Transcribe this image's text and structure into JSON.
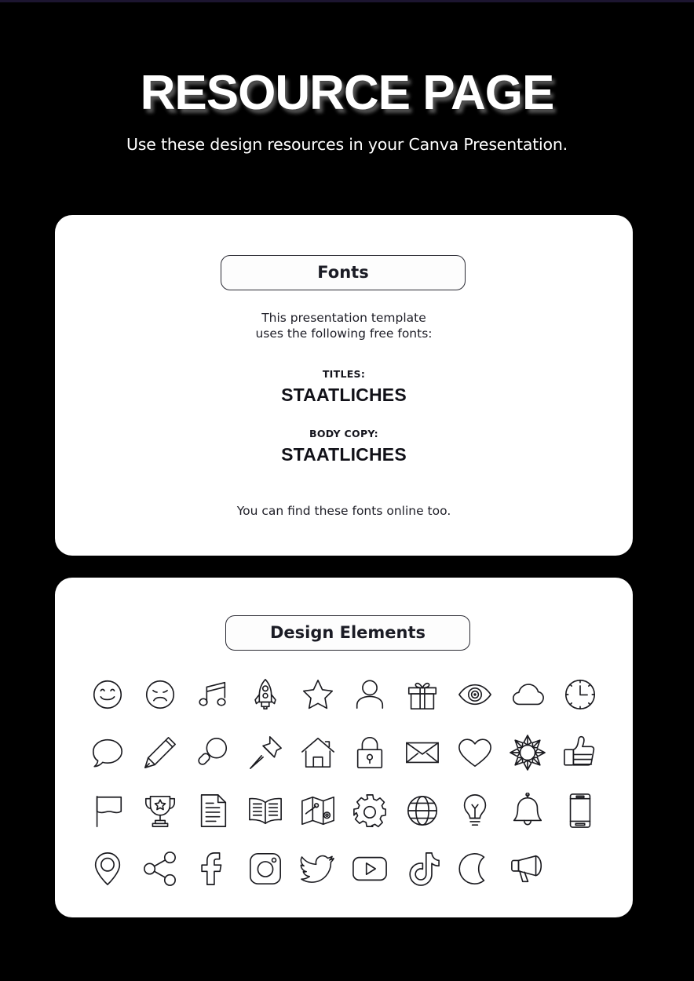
{
  "theme": {
    "background": "#000000",
    "top_strip": "#1c1530",
    "card_background": "#ffffff",
    "text_dark": "#1b1c25",
    "text_light": "#ffffff",
    "icon_stroke": "#1a1a1f"
  },
  "header": {
    "title": "RESOURCE PAGE",
    "subtitle": "Use these design resources in your Canva Presentation."
  },
  "fonts_card": {
    "pill_label": "Fonts",
    "intro_line1": "This presentation template",
    "intro_line2": "uses the following free fonts:",
    "titles_label": "TITLES:",
    "titles_font": "STAATLICHES",
    "body_label": "BODY COPY:",
    "body_font": "STAATLICHES",
    "footer": "You can find these fonts online too."
  },
  "elements_card": {
    "pill_label": "Design Elements",
    "icons": [
      {
        "name": "smiley-face-icon",
        "label": "Smiley Face"
      },
      {
        "name": "sad-face-icon",
        "label": "Sad Face"
      },
      {
        "name": "music-note-icon",
        "label": "Music Note"
      },
      {
        "name": "rocket-icon",
        "label": "Rocket"
      },
      {
        "name": "star-icon",
        "label": "Star"
      },
      {
        "name": "person-icon",
        "label": "Person"
      },
      {
        "name": "gift-icon",
        "label": "Gift"
      },
      {
        "name": "eye-icon",
        "label": "Eye"
      },
      {
        "name": "cloud-icon",
        "label": "Cloud"
      },
      {
        "name": "clock-icon",
        "label": "Clock"
      },
      {
        "name": "speech-bubble-icon",
        "label": "Speech Bubble"
      },
      {
        "name": "pencil-icon",
        "label": "Pencil"
      },
      {
        "name": "magnifier-icon",
        "label": "Magnifying Glass"
      },
      {
        "name": "pushpin-icon",
        "label": "Pushpin"
      },
      {
        "name": "house-icon",
        "label": "House"
      },
      {
        "name": "lock-icon",
        "label": "Lock"
      },
      {
        "name": "envelope-icon",
        "label": "Envelope"
      },
      {
        "name": "heart-icon",
        "label": "Heart"
      },
      {
        "name": "sun-icon",
        "label": "Sun"
      },
      {
        "name": "thumbs-up-icon",
        "label": "Thumbs Up"
      },
      {
        "name": "flag-icon",
        "label": "Flag"
      },
      {
        "name": "trophy-icon",
        "label": "Trophy"
      },
      {
        "name": "document-icon",
        "label": "Document"
      },
      {
        "name": "open-book-icon",
        "label": "Open Book"
      },
      {
        "name": "map-icon",
        "label": "Map"
      },
      {
        "name": "gear-icon",
        "label": "Gear"
      },
      {
        "name": "globe-icon",
        "label": "Globe"
      },
      {
        "name": "lightbulb-icon",
        "label": "Light Bulb"
      },
      {
        "name": "bell-icon",
        "label": "Bell"
      },
      {
        "name": "phone-icon",
        "label": "Mobile Phone"
      },
      {
        "name": "location-pin-icon",
        "label": "Location Pin"
      },
      {
        "name": "share-icon",
        "label": "Share"
      },
      {
        "name": "facebook-icon",
        "label": "Facebook"
      },
      {
        "name": "instagram-icon",
        "label": "Instagram"
      },
      {
        "name": "twitter-icon",
        "label": "Twitter"
      },
      {
        "name": "youtube-icon",
        "label": "YouTube"
      },
      {
        "name": "tiktok-icon",
        "label": "TikTok"
      },
      {
        "name": "moon-icon",
        "label": "Moon"
      },
      {
        "name": "megaphone-icon",
        "label": "Megaphone"
      }
    ]
  }
}
